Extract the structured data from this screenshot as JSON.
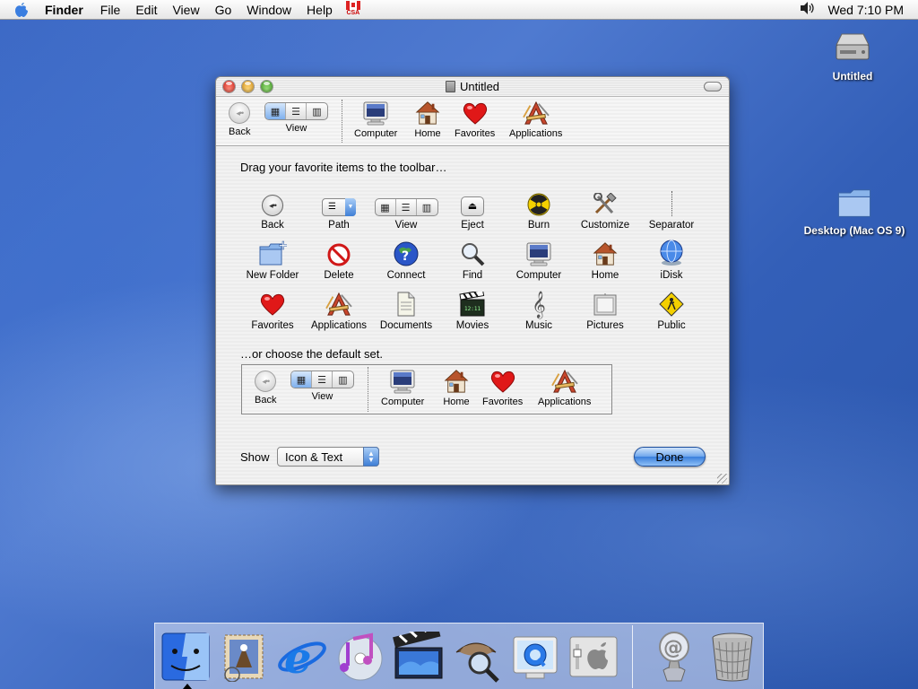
{
  "menubar": {
    "app": "Finder",
    "items": [
      "File",
      "Edit",
      "View",
      "Go",
      "Window",
      "Help"
    ],
    "flag_text": "CSA",
    "clock": "Wed 7:10 PM"
  },
  "desktop": {
    "icons": [
      {
        "label": "Untitled"
      },
      {
        "label": "Desktop (Mac OS 9)"
      }
    ]
  },
  "window": {
    "title": "Untitled",
    "toolbar": {
      "back": "Back",
      "view": "View",
      "computer": "Computer",
      "home": "Home",
      "favorites": "Favorites",
      "applications": "Applications"
    },
    "drag_heading": "Drag your favorite items to the toolbar…",
    "items": [
      "Back",
      "Path",
      "View",
      "Eject",
      "Burn",
      "Customize",
      "Separator",
      "New Folder",
      "Delete",
      "Connect",
      "Find",
      "Computer",
      "Home",
      "iDisk",
      "Favorites",
      "Applications",
      "Documents",
      "Movies",
      "Music",
      "Pictures",
      "Public"
    ],
    "default_heading": "…or choose the default set.",
    "default_set": {
      "back": "Back",
      "view": "View",
      "computer": "Computer",
      "home": "Home",
      "favorites": "Favorites",
      "applications": "Applications"
    },
    "show_label": "Show",
    "show_value": "Icon & Text",
    "done_label": "Done"
  },
  "dock": {
    "items": [
      "finder-icon",
      "mail-icon",
      "internet-explorer-icon",
      "itunes-icon",
      "imovie-icon",
      "sherlock-icon",
      "quicktime-icon",
      "system-preferences-icon",
      "url-icon",
      "trash-icon"
    ]
  },
  "colors": {
    "accent": "#3a7fdc",
    "desktop": "#3c68c4"
  }
}
